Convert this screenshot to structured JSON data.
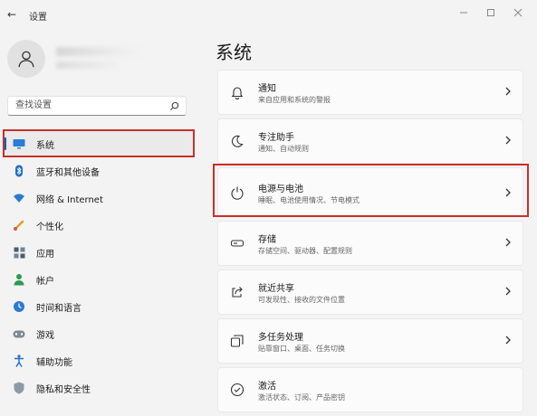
{
  "window": {
    "title": "设置"
  },
  "search": {
    "placeholder": "查找设置"
  },
  "nav": {
    "items": [
      {
        "label": "系统",
        "icon": "monitor-icon",
        "active": true
      },
      {
        "label": "蓝牙和其他设备",
        "icon": "bluetooth-icon"
      },
      {
        "label": "网络 & Internet",
        "icon": "wifi-icon"
      },
      {
        "label": "个性化",
        "icon": "brush-icon"
      },
      {
        "label": "应用",
        "icon": "apps-icon"
      },
      {
        "label": "帐户",
        "icon": "person-icon"
      },
      {
        "label": "时间和语言",
        "icon": "globe-clock-icon"
      },
      {
        "label": "游戏",
        "icon": "gamepad-icon"
      },
      {
        "label": "辅助功能",
        "icon": "accessibility-icon"
      },
      {
        "label": "隐私和安全性",
        "icon": "shield-icon"
      }
    ]
  },
  "main": {
    "title": "系统",
    "cards": [
      {
        "title": "通知",
        "subtitle": "来自应用和系统的警报",
        "icon": "bell-icon"
      },
      {
        "title": "专注助手",
        "subtitle": "通知、自动规则",
        "icon": "moon-icon"
      },
      {
        "title": "电源与电池",
        "subtitle": "睡眠、电池使用情况、节电模式",
        "icon": "power-icon",
        "highlighted": true
      },
      {
        "title": "存储",
        "subtitle": "存储空间、驱动器、配置规则",
        "icon": "storage-icon"
      },
      {
        "title": "就近共享",
        "subtitle": "可发现性、接收的文件位置",
        "icon": "share-icon"
      },
      {
        "title": "多任务处理",
        "subtitle": "贴靠窗口、桌面、任务切换",
        "icon": "multitask-icon"
      },
      {
        "title": "激活",
        "subtitle": "激活状态、订阅、产品密钥",
        "icon": "check-circle-icon"
      }
    ]
  },
  "colors": {
    "accent": "#005fb8",
    "highlight": "#c9302c"
  }
}
